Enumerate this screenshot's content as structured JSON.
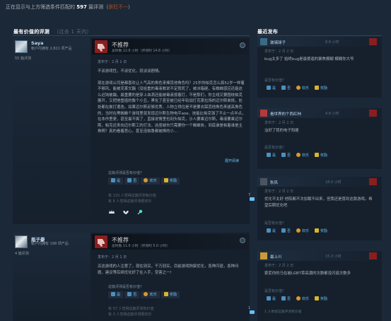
{
  "header": {
    "prefix": "正在显示与上方筛选条件匹配的 ",
    "count": "597",
    "suffix": " 篇评测（",
    "rating": "褒贬不一",
    "close": "）"
  },
  "left_section": {
    "title": "最有价值的评测",
    "subtitle": "（过去 1 天内）"
  },
  "right_section": {
    "title": "最近发布"
  },
  "reviews": [
    {
      "name": "Saya",
      "games": "帐户内拥有 2,821 项产品",
      "review_count": "55 篇评测",
      "verdict": "不推荐",
      "hours": "总时数 22.8 小时（评测时 14.8 小时）",
      "posted": "发布于：2 月 1 日",
      "paragraphs": [
        "不谈游戏性，不谈优化，就谈谈剧情。",
        "现在游戏公司是都喜欢让人气高的角色来捧其他角色吗？25岁的帕克怎么屌52岁一样着不够风，能被克莱文踹（没给重的毒液救说不定我死了，被冰箱砸，有蜘蛛感应还能这么迟钝被踹，最重要的是穿上血滴还能被毒液按着打，不是那们，你主线又要围绕帕克展开，又把他塑造的像个小丑，黑化了甚至被已经年轮战打克莱拉场的迈尔斯单挑，处处都在挨打遭迭。如果迈尔斯足够优秀，人物立得住是不是要去踩其他角色来拔高角色的，当时在黑蜘蛛个游戏里就发现迈尔斯生物电平aoe、技能比帕克强了不止一点半点，在本作里更，甚至最不爽了，直接说情里也刻头帕克，沙人要乘迈尔斯，毒液要乘迈尔斯，帕克还来向迈尔斯工的打法，这座城市只需要你一个蜘蛛侠，到底谁是帕着谁是主角啊？真的看着恶心，甚至连帕鲁都被捧的小…"
      ],
      "read_more": "展开阅读",
      "helpful_q": "这篇评测是否有价值？",
      "btn_yes": "是",
      "btn_no": "否",
      "btn_funny": "欢乐",
      "btn_award": "奖励",
      "stat1": "有 110 人觉得这篇评测有价值",
      "stat2": "有 6 人觉得这篇评测很欢乐",
      "comments": "7"
    },
    {
      "name": "瓶子豪",
      "games": "帐户内拥有 198 项产品",
      "review_count": "4 篇评测",
      "verdict": "不推荐",
      "hours": "总时数 11.0 小时（评测时 5.0 小时）",
      "posted": "发布于：2 月 1 日",
      "paragraphs": [
        "买这游戏的人注意了，现在别买，千万别买，目前游戏狗屎优化，各种闪退，各种问题，建议等后续优化好了在入手，受害之一!"
      ],
      "helpful_q": "这篇评测是否有价值？",
      "btn_yes": "是",
      "btn_no": "否",
      "btn_funny": "欢乐",
      "btn_award": "奖励",
      "stat1": "有 57 人觉得这篇评测有价值",
      "stat2": "有 3 人觉得这篇评测很欢乐",
      "comments": "1"
    }
  ],
  "recent": [
    {
      "name": "玻璃球子",
      "hours": "8.8 小时",
      "posted": "发布于：2 月 2 日",
      "text": "bug太多了 始终bug是最傻逼的聚焦模糊 模糊你大爷",
      "helpful_q": "是否有价值？",
      "btn_yes": "是",
      "btn_no": "否",
      "btn_funny": "欢乐",
      "btn_award": "奖励"
    },
    {
      "name": "看世界的个西红柿",
      "hours": "4.8 小时",
      "posted": "发布于：2 月 2 日",
      "text": "治好了我的电子阳痿",
      "helpful_q": "是否有价值？",
      "btn_yes": "是",
      "btn_no": "否",
      "btn_funny": "欢乐",
      "btn_award": "奖励"
    },
    {
      "name": "秋风",
      "hours": "18.0 小时",
      "posted": "发布于：2 月 2 日",
      "text": "优化不太好 他院都不次加载不出来，但我还是喜欢这款游戏。希望后期优化吧",
      "helpful_q": "是否有价值？",
      "btn_yes": "是",
      "btn_no": "否",
      "btn_funny": "欢乐",
      "btn_award": "奖励"
    },
    {
      "name": "最上川",
      "hours": "15.3 小时",
      "posted": "发布于：2 月 2 日",
      "text": "索尼你的马在被LGBT草高潮的次数都没闪退次数多",
      "helpful_q": "是否有价值？",
      "btn_yes": "是",
      "btn_no": "否",
      "btn_funny": "欢乐",
      "btn_award": "奖励",
      "stat": "1 人觉得这篇评测有价值"
    }
  ],
  "colors": {
    "background": "#1b2838",
    "card": "#16202d",
    "link": "#66c0f4",
    "negative": "#8a1e1e",
    "mixed": "#a34c25"
  }
}
